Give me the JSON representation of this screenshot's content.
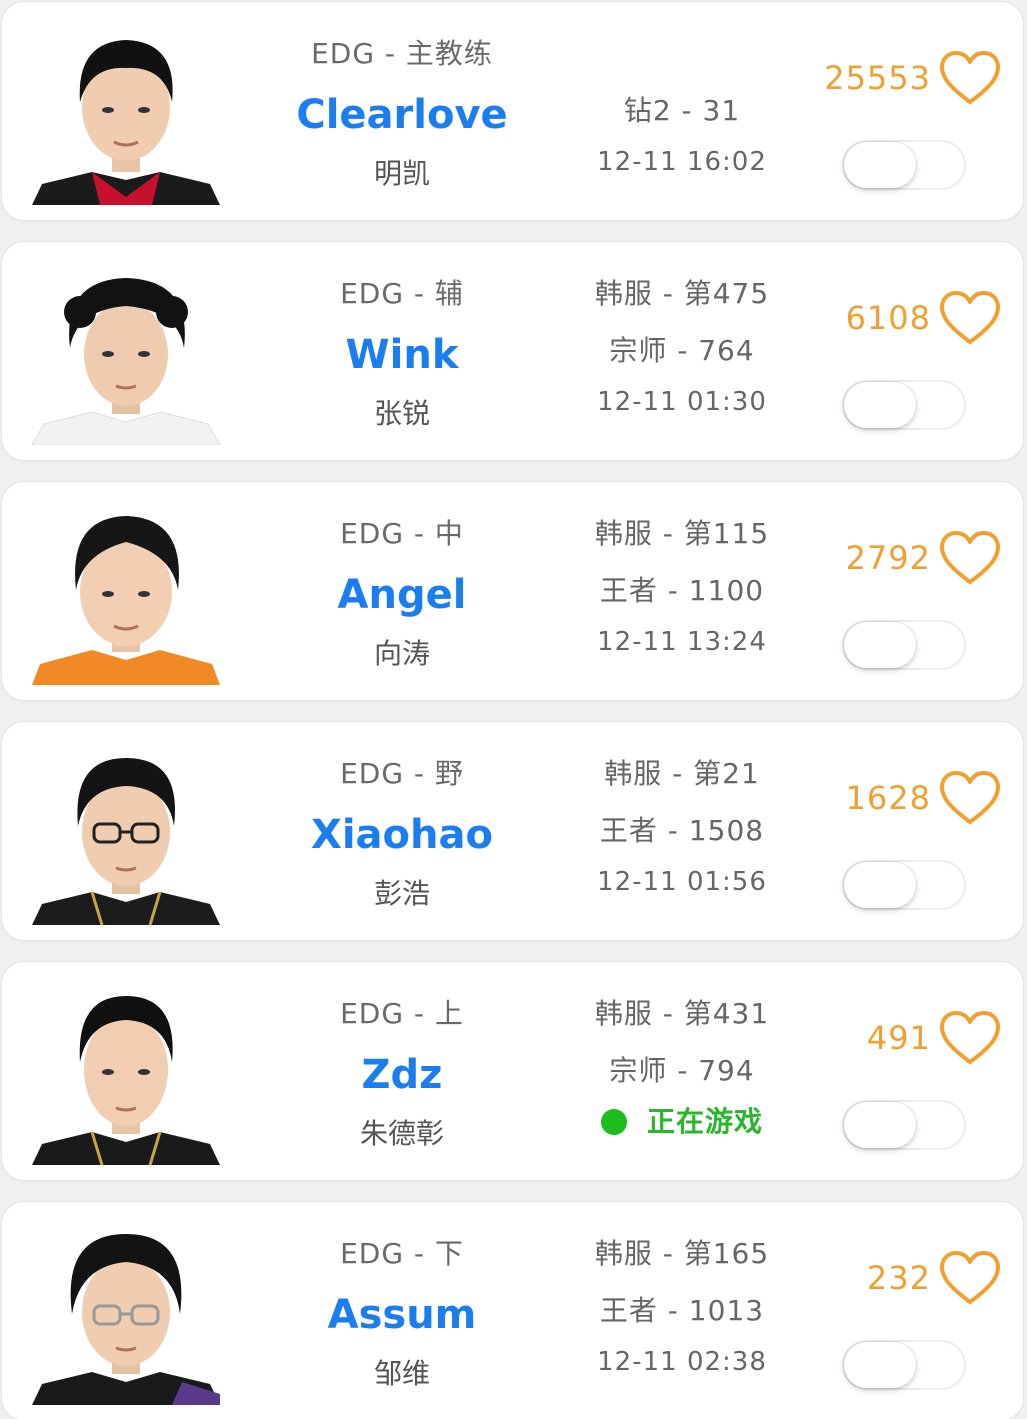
{
  "colors": {
    "nickname": "#1a7ef0",
    "likes": "#f0a030",
    "live": "#2bb52b"
  },
  "players": [
    {
      "team_position": "EDG - 主教练",
      "nickname": "Clearlove",
      "real_name": "明凯",
      "rank_lines": [
        "钻2 - 31"
      ],
      "last_seen": "12-11 16:02",
      "likes": "25553",
      "notify_on": false
    },
    {
      "team_position": "EDG - 辅",
      "nickname": "Wink",
      "real_name": "张锐",
      "rank_lines": [
        "韩服 - 第475",
        "宗师 - 764"
      ],
      "last_seen": "12-11 01:30",
      "likes": "6108",
      "notify_on": false
    },
    {
      "team_position": "EDG - 中",
      "nickname": "Angel",
      "real_name": "向涛",
      "rank_lines": [
        "韩服 - 第115",
        "王者 - 1100"
      ],
      "last_seen": "12-11 13:24",
      "likes": "2792",
      "notify_on": false
    },
    {
      "team_position": "EDG - 野",
      "nickname": "Xiaohao",
      "real_name": "彭浩",
      "rank_lines": [
        "韩服 - 第21",
        "王者 - 1508"
      ],
      "last_seen": "12-11 01:56",
      "likes": "1628",
      "notify_on": false
    },
    {
      "team_position": "EDG - 上",
      "nickname": "Zdz",
      "real_name": "朱德彰",
      "rank_lines": [
        "韩服 - 第431",
        "宗师 - 794"
      ],
      "live_status": "正在游戏",
      "likes": "491",
      "notify_on": false
    },
    {
      "team_position": "EDG - 下",
      "nickname": "Assum",
      "real_name": "邹维",
      "rank_lines": [
        "韩服 - 第165",
        "王者 - 1013"
      ],
      "last_seen": "12-11 02:38",
      "likes": "232",
      "notify_on": false
    }
  ]
}
